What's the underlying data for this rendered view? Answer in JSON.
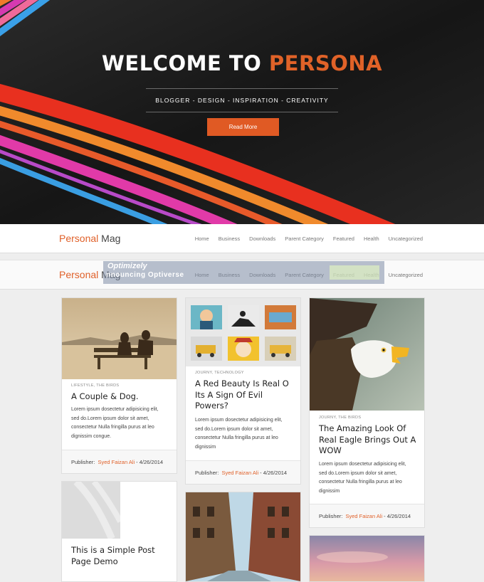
{
  "hero": {
    "title_part1": "WELCOME TO ",
    "title_part2": "PERSONA",
    "tagline": "BLOGGER - DESIGN - INSPIRATION - CREATIVITY",
    "button_label": "Read More"
  },
  "brand": {
    "part1": "Personal",
    "part2": " Mag"
  },
  "nav": [
    "Home",
    "Business",
    "Downloads",
    "Parent Category",
    "Featured",
    "Health",
    "Uncategorized"
  ],
  "ad": {
    "logo": "Optimizely",
    "text": "nnouncing Optiverse"
  },
  "colors": {
    "accent": "#e0612a",
    "hero_bg": "#1b1b1b"
  },
  "posts": [
    {
      "category": "LIFESTYLE, THE BIRDS",
      "title": "A Couple & Dog.",
      "excerpt": [
        "Lorem ipsum dosectetur adipisicing elit,",
        "sed do.Lorem ipsum dolor sit amet,",
        "consectetur Nulla fringilla purus at leo",
        "dignissim congue."
      ],
      "publisher_label": "Publisher:",
      "author": "Syed Faizan Ali",
      "date": "- 4/26/2014"
    },
    {
      "category": "JOURNY, TECHNOLOGY",
      "title": [
        "A Red Beauty Is Real O",
        "Its A Sign Of Evil",
        "Powers?"
      ],
      "excerpt": [
        "Lorem ipsum dosectetur adipisicing elit,",
        "sed do.Lorem ipsum dolor sit amet,",
        "consectetur Nulla fringilla purus at leo",
        "dignissim"
      ],
      "publisher_label": "Publisher:",
      "author": "Syed Faizan Ali",
      "date": "- 4/26/2014"
    },
    {
      "category": "JOURNY, THE BIRDS",
      "title": [
        "The Amazing Look Of",
        "Real Eagle Brings Out A",
        "WOW"
      ],
      "excerpt": [
        "Lorem ipsum dosectetur adipisicing elit,",
        "sed do.Lorem ipsum dolor sit amet,",
        "consectetur Nulla fringilla purus at leo",
        "dignissim"
      ],
      "publisher_label": "Publisher:",
      "author": "Syed Faizan Ali",
      "date": "- 4/26/2014"
    },
    {
      "title": [
        "This is a Simple Post",
        "Page Demo"
      ]
    }
  ]
}
